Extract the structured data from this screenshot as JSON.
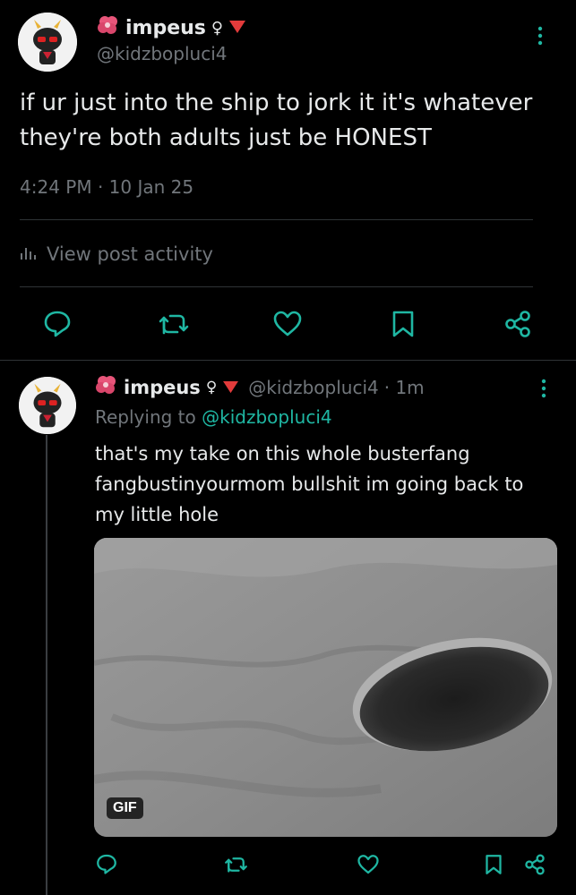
{
  "main_post": {
    "display_name": "impeus",
    "handle": "@kidzbopluci4",
    "text_line1": "if ur just into the ship to jork it it's whatever",
    "text_line2": "they're both adults just be HONEST",
    "timestamp": "4:24 PM · 10 Jan 25",
    "activity_label": "View post activity"
  },
  "reply": {
    "display_name": "impeus",
    "handle": "@kidzbopluci4",
    "time": "· 1m",
    "replying_to_prefix": "Replying to",
    "replying_to_handle": "@kidzbopluci4",
    "text_line1": "that's my take on this whole busterfang",
    "text_line2": "fangbustinyourmom bullshit im going back to",
    "text_line3": "my little hole",
    "media_badge": "GIF"
  },
  "icons": {
    "flower": "hibiscus-icon",
    "symbol": "female-symbol-icon",
    "triangle": "red-triangle-icon",
    "reply": "reply-icon",
    "repost": "repost-icon",
    "like": "like-icon",
    "bookmark": "bookmark-icon",
    "share": "share-icon",
    "more": "more-icon"
  },
  "colors": {
    "accent": "#1fb7a3",
    "background": "#000000",
    "text": "#e7e9ea",
    "muted": "#71767b"
  }
}
